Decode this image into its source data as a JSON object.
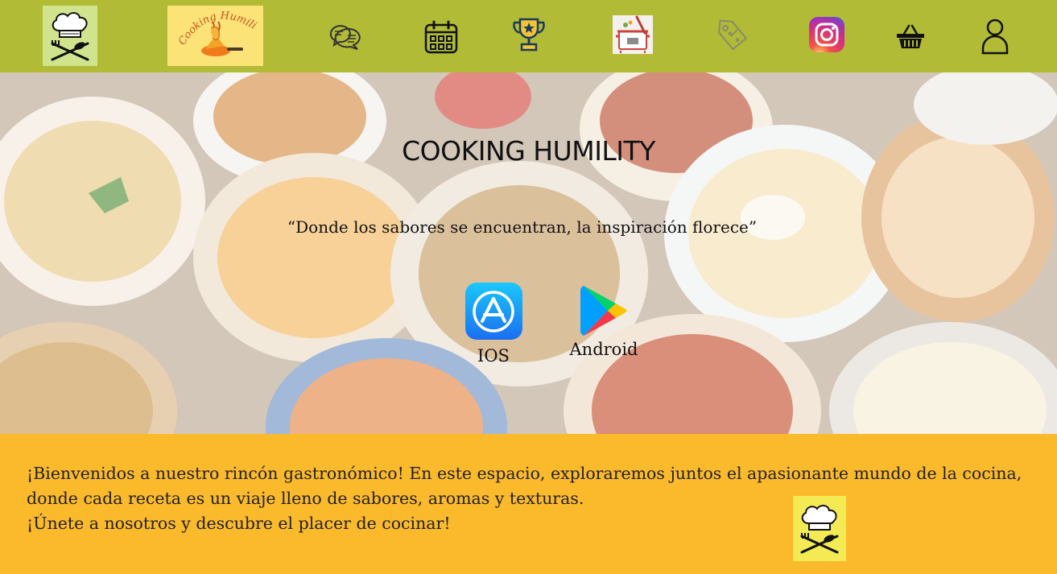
{
  "nav": {
    "logo_icon": "chef-hat-utensils-icon",
    "brand_icon": "cooking-humility-brand-logo",
    "brand_text": "Cooking Humility",
    "items": [
      {
        "name": "chat",
        "icon": "chat-bubbles-icon"
      },
      {
        "name": "calendar",
        "icon": "calendar-icon"
      },
      {
        "name": "trophy",
        "icon": "trophy-icon"
      },
      {
        "name": "recipes",
        "icon": "cooking-pot-icon"
      },
      {
        "name": "offers",
        "icon": "price-tag-icon"
      },
      {
        "name": "instagram",
        "icon": "instagram-icon"
      },
      {
        "name": "cart",
        "icon": "shopping-basket-icon"
      },
      {
        "name": "profile",
        "icon": "user-icon"
      }
    ],
    "colors": {
      "bar": "#b1bb35",
      "logo_bg": "#cfe48c",
      "brand_bg": "#fbe378"
    }
  },
  "hero": {
    "title": "COOKING HUMILITY",
    "quote": "“Donde los sabores se encuentran, la inspiración florece”",
    "stores": {
      "ios": {
        "label": "IOS",
        "icon": "app-store-icon"
      },
      "android": {
        "label": "Android",
        "icon": "google-play-icon"
      }
    }
  },
  "welcome": {
    "line1": "¡Bienvenidos a nuestro rincón gastronómico! En este espacio,  exploraremos juntos el apasionante mundo de la cocina,",
    "line2": "donde cada receta  es un viaje lleno de sabores, aromas y texturas.",
    "line3": "¡Únete a nosotros y descubre el placer de cocinar!",
    "colors": {
      "background": "#fbb92c",
      "logo_bg": "#f4eb54"
    }
  }
}
